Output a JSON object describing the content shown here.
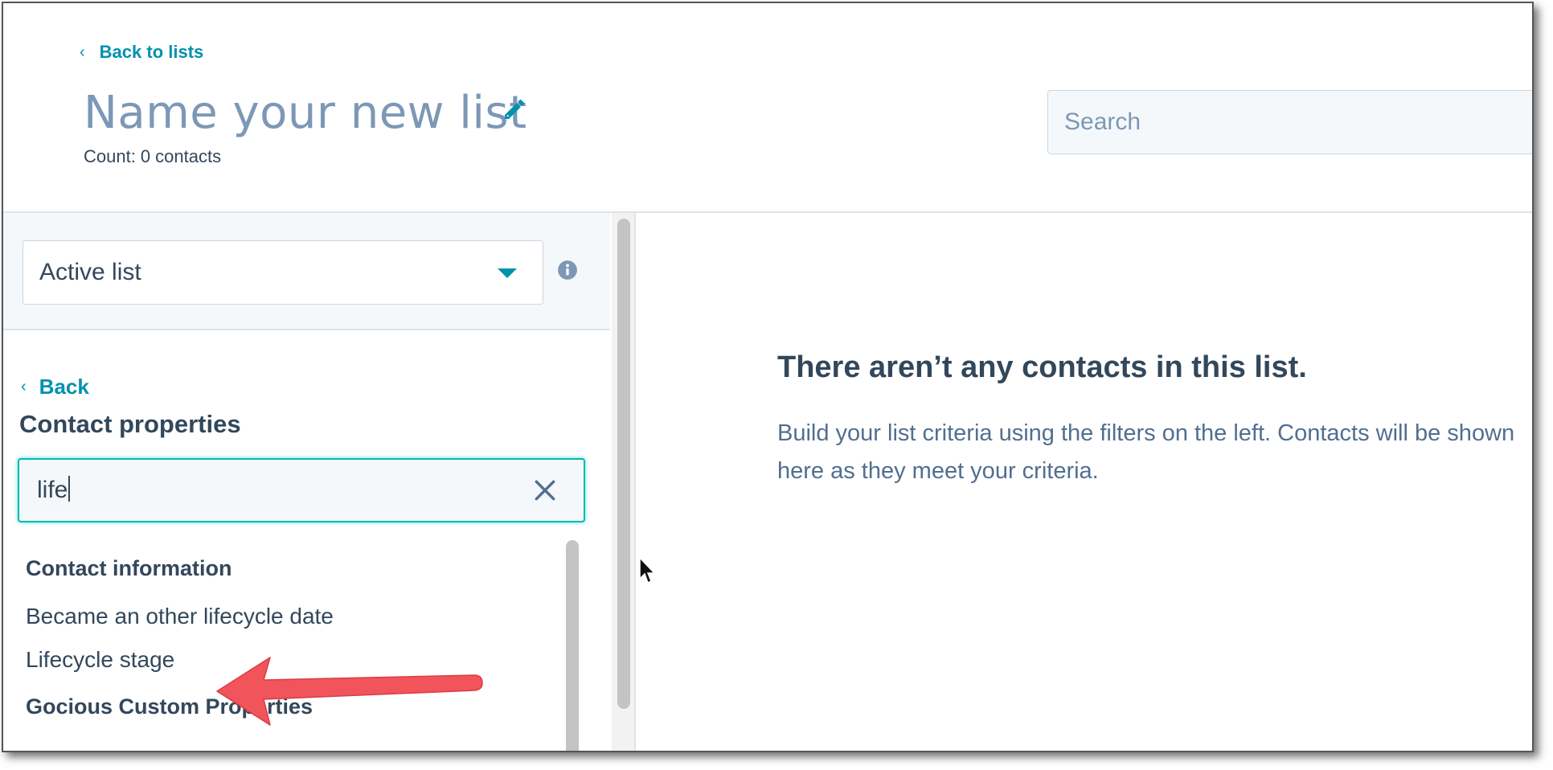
{
  "header": {
    "back_label": "Back to lists",
    "title": "Name your new list",
    "count_label": "Count:",
    "count_value": "0 contacts",
    "search_placeholder": "Search"
  },
  "left_panel": {
    "list_type": "Active list",
    "back_label": "Back",
    "section_title": "Contact properties",
    "filter_value": "life",
    "groups": [
      {
        "heading": "Contact information",
        "items": [
          "Became an other lifecycle date",
          "Lifecycle stage"
        ]
      },
      {
        "heading": "Gocious Custom Properties",
        "items": []
      }
    ]
  },
  "empty_state": {
    "title": "There aren’t any contacts in this list.",
    "description": "Build your list criteria using the filters on the left. Contacts will be shown here as they meet your criteria."
  },
  "annotation": {
    "arrow_color": "#f2545b",
    "target": "Lifecycle stage"
  },
  "colors": {
    "accent": "#0091ae",
    "title": "#7c98b6",
    "text": "#33475b",
    "focus_border": "#00bda5"
  },
  "icons": {
    "edit": "pencil-icon",
    "info": "info-icon",
    "clear": "close-icon",
    "back": "chevron-left-icon",
    "dropdown": "caret-down-icon"
  }
}
